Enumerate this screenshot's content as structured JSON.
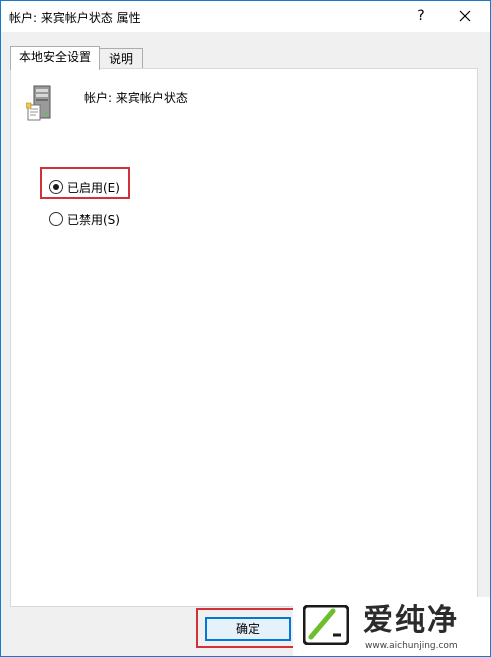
{
  "window": {
    "title": "帐户: 来宾帐户状态 属性",
    "help_label": "?",
    "close_icon": "close-icon"
  },
  "tabs": [
    {
      "label": "本地安全设置",
      "active": true
    },
    {
      "label": "说明",
      "active": false
    }
  ],
  "policy": {
    "icon": "server-icon",
    "name": "帐户: 来宾帐户状态"
  },
  "options": [
    {
      "label": "已启用(E)",
      "checked": true
    },
    {
      "label": "已禁用(S)",
      "checked": false
    }
  ],
  "buttons": {
    "ok_label": "确定"
  },
  "watermark": {
    "brand": "爱纯净",
    "url": "www.aichunjing.com"
  },
  "colors": {
    "highlight": "#d0323c",
    "accent": "#0078d7"
  }
}
